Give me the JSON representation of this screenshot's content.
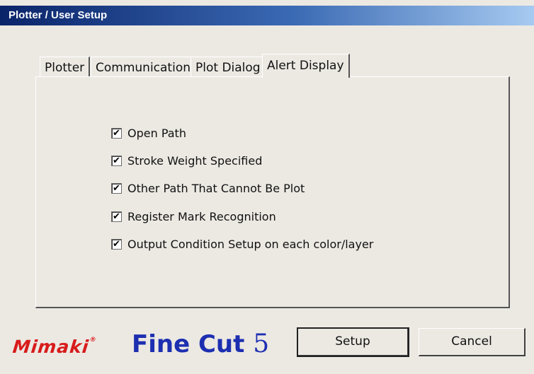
{
  "window": {
    "title": "Plotter / User Setup"
  },
  "tabs": [
    {
      "label": "Plotter",
      "active": false
    },
    {
      "label": "Communication",
      "active": false
    },
    {
      "label": "Plot Dialog",
      "active": false
    },
    {
      "label": "Alert Display",
      "active": true
    }
  ],
  "alerts": [
    {
      "label": "Open Path",
      "checked": true
    },
    {
      "label": "Stroke Weight Specified",
      "checked": true
    },
    {
      "label": "Other Path That Cannot Be Plot",
      "checked": true
    },
    {
      "label": "Register Mark Recognition",
      "checked": true
    },
    {
      "label": "Output Condition Setup on each color/layer",
      "checked": true
    }
  ],
  "branding": {
    "mimaki": "Mimaki",
    "product": "Fine Cut",
    "version": "5",
    "brand_color": "#d81b1b",
    "product_color": "#1d2fb0"
  },
  "buttons": {
    "setup": "Setup",
    "cancel": "Cancel"
  }
}
